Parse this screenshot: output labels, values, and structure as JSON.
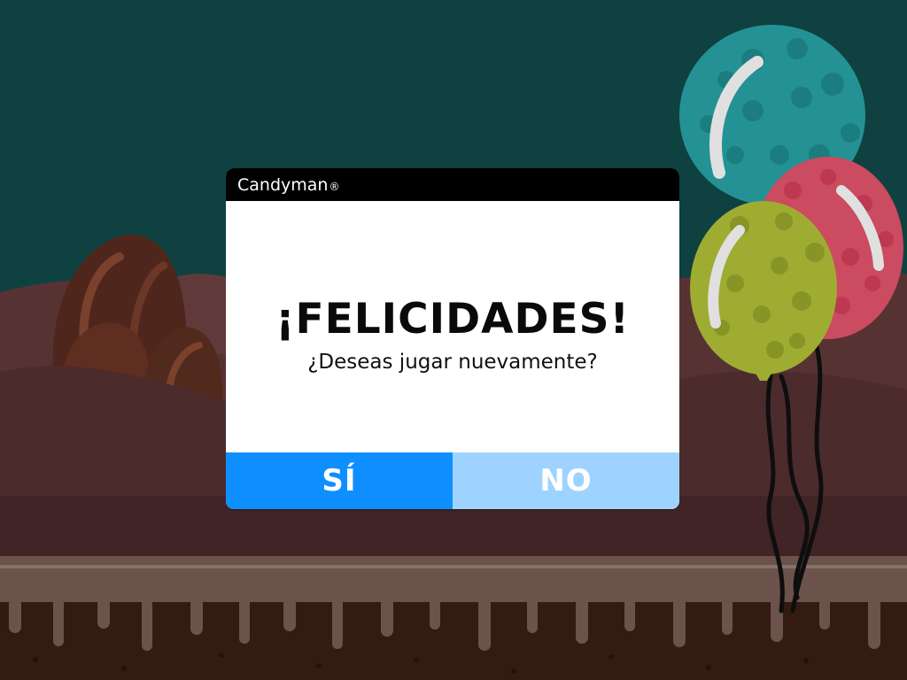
{
  "dialog": {
    "title": "Candyman",
    "title_mark": "®",
    "headline": "¡FELICIDADES!",
    "subtitle": "¿Deseas jugar nuevamente?",
    "yes_label": "SÍ",
    "no_label": "NO"
  },
  "colors": {
    "sky": "#124a4b",
    "hills_back": "#5b3637",
    "hills_front": "#4a2a2c",
    "cake": "#3b1f14",
    "frosting": "#8a7066",
    "dialog_title_bg": "#000000",
    "dialog_bg": "#ffffff",
    "yes_bg": "#0f8fff",
    "no_bg": "#9ed3ff",
    "balloon_teal": "#2aa7a9",
    "balloon_pink": "#e8566f",
    "balloon_lime": "#b6c43a"
  },
  "icons": [
    "chocolate-rock-icon",
    "balloon-icon"
  ]
}
